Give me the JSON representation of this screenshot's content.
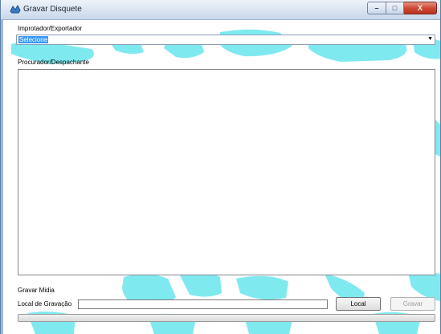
{
  "window": {
    "title": "Gravar Disquete",
    "icon": "app-icon"
  },
  "controls": {
    "minimize": "–",
    "maximize": "□",
    "close": "X"
  },
  "importer": {
    "label": "Improtador/Exportador",
    "selected_value": "Selecione"
  },
  "dispatcher": {
    "label": "Procurador/Despachante",
    "items": []
  },
  "media": {
    "section_label": "Gravar Midia",
    "location_label": "Local de Gravação",
    "location_value": "",
    "local_button": "Local",
    "record_button": "Gravar",
    "progress": 0
  },
  "colors": {
    "map": "#7fe9f0",
    "selection": "#3399ff",
    "close": "#cd4a35"
  }
}
